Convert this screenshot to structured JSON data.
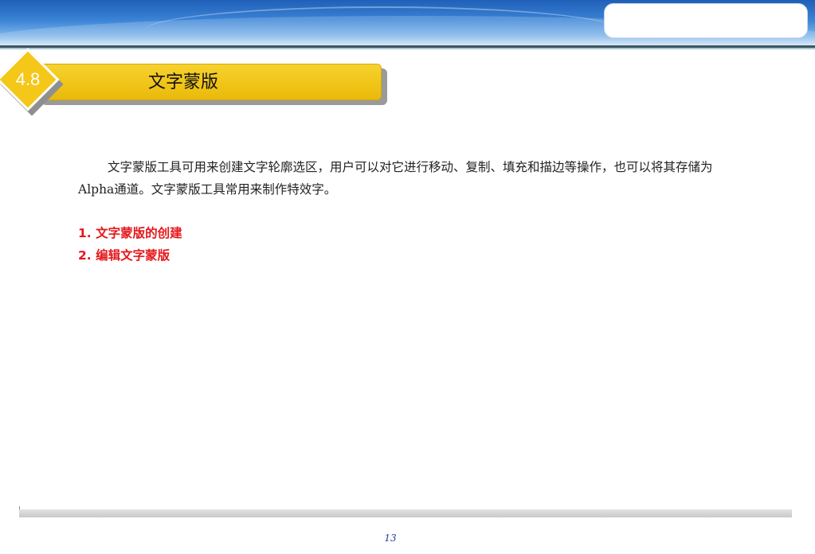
{
  "header": {
    "section_number": "4.8",
    "section_title": "文字蒙版"
  },
  "content": {
    "intro": "文字蒙版工具可用来创建文字轮廓选区，用户可以对它进行移动、复制、填充和描边等操作，也可以将其存储为Alpha通道。文字蒙版工具常用来制作特效字。",
    "topics": [
      "1. 文字蒙版的创建",
      "2. 编辑文字蒙版"
    ]
  },
  "footer": {
    "page_number": "13"
  },
  "colors": {
    "banner_blue": "#3b84d6",
    "heading_yellow": "#f0c416",
    "topic_red": "#e5171b",
    "page_number_blue": "#1f3f9a"
  }
}
